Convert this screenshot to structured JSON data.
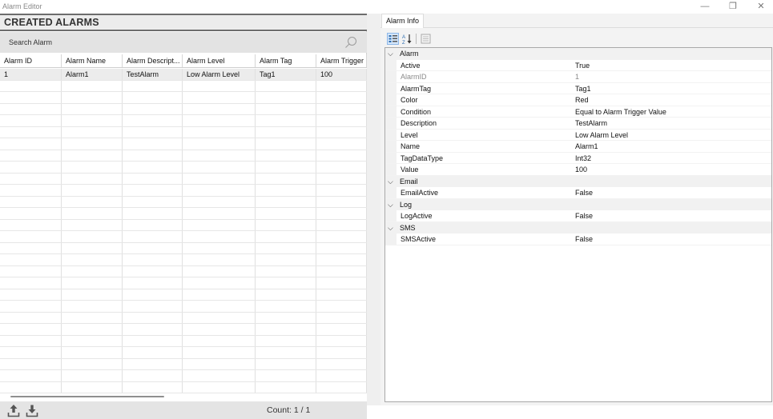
{
  "window": {
    "title": "Alarm Editor",
    "minimize_glyph": "—",
    "restore_glyph": "❐",
    "close_glyph": "✕"
  },
  "alarms_panel": {
    "title": "CREATED ALARMS",
    "search_placeholder": "Search Alarm",
    "columns": [
      "Alarm ID",
      "Alarm Name",
      "Alarm Descript...",
      "Alarm Level",
      "Alarm Tag",
      "Alarm Trigger"
    ],
    "rows": [
      [
        "1",
        "Alarm1",
        "TestAlarm",
        "Low Alarm Level",
        "Tag1",
        "100"
      ]
    ],
    "count_label": "Count: 1 / 1"
  },
  "alarm_info": {
    "tab_label": "Alarm Info",
    "categories": [
      {
        "name": "Alarm",
        "properties": [
          {
            "name": "Active",
            "value": "True",
            "disabled": false
          },
          {
            "name": "AlarmID",
            "value": "1",
            "disabled": true
          },
          {
            "name": "AlarmTag",
            "value": "Tag1",
            "disabled": false
          },
          {
            "name": "Color",
            "value": "Red",
            "disabled": false
          },
          {
            "name": "Condition",
            "value": "Equal to Alarm Trigger Value",
            "disabled": false
          },
          {
            "name": "Description",
            "value": "TestAlarm",
            "disabled": false
          },
          {
            "name": "Level",
            "value": "Low Alarm Level",
            "disabled": false
          },
          {
            "name": "Name",
            "value": "Alarm1",
            "disabled": false
          },
          {
            "name": "TagDataType",
            "value": "Int32",
            "disabled": false
          },
          {
            "name": "Value",
            "value": "100",
            "disabled": false
          }
        ]
      },
      {
        "name": "Email",
        "properties": [
          {
            "name": "EmailActive",
            "value": "False",
            "disabled": false
          }
        ]
      },
      {
        "name": "Log",
        "properties": [
          {
            "name": "LogActive",
            "value": "False",
            "disabled": false
          }
        ]
      },
      {
        "name": "SMS",
        "properties": [
          {
            "name": "SMSActive",
            "value": "False",
            "disabled": false
          }
        ]
      }
    ]
  },
  "icons": {
    "search": "search-icon",
    "export": "upload-icon",
    "import": "download-icon",
    "categorized": "categorized-icon",
    "alphabetical": "sort-alphabetical-icon",
    "property_pages": "property-pages-icon",
    "expander": "chevron-down-icon"
  },
  "colors": {
    "header_border": "#6d6d6d",
    "search_background": "#e3e3e3",
    "selected_row": "#ececec",
    "toolbar_active": "#d4e6fa",
    "icon_gray": "#555555"
  }
}
